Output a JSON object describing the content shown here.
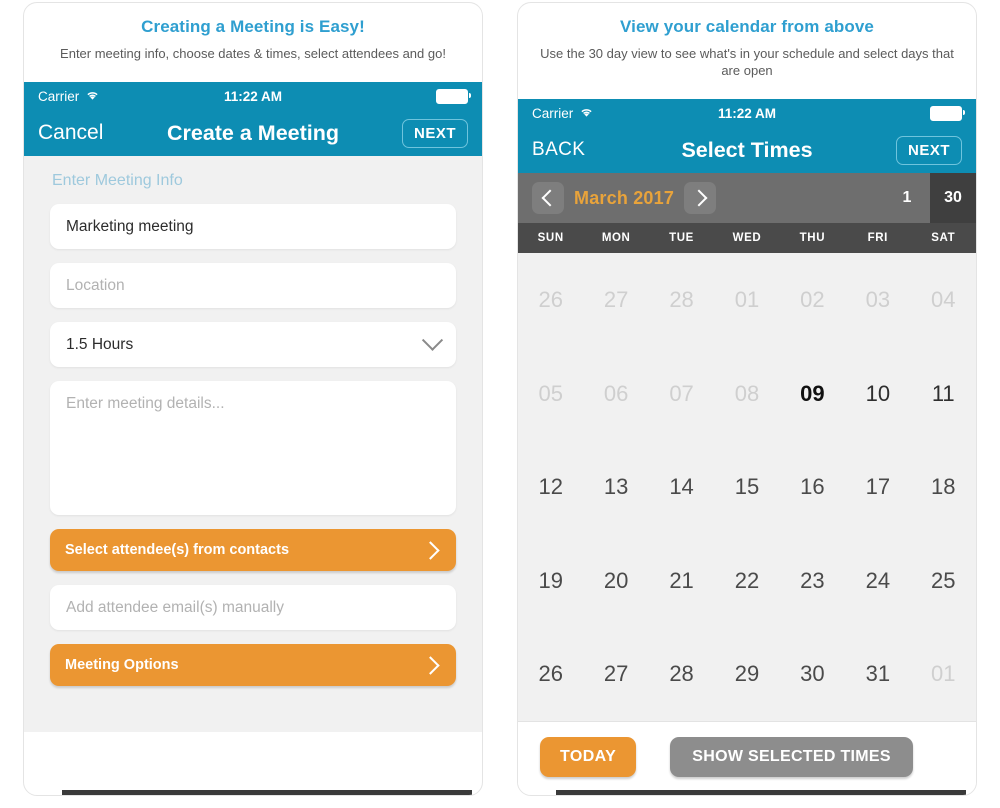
{
  "panels": {
    "left": {
      "promo_title": "Creating a Meeting is Easy!",
      "promo_sub": "Enter meeting info, choose dates & times, select attendees and go!",
      "status": {
        "carrier": "Carrier",
        "wifi_icon": "wifi-icon",
        "time": "11:22 AM",
        "battery_icon": "battery-icon"
      },
      "nav": {
        "left_label": "Cancel",
        "title": "Create a Meeting",
        "next_label": "NEXT"
      },
      "form": {
        "section_label": "Enter Meeting Info",
        "title_value": "Marketing meeting",
        "location_placeholder": "Location",
        "duration_value": "1.5 Hours",
        "duration_chevron_icon": "chevron-down-icon",
        "details_placeholder": "Enter meeting details...",
        "select_attendees_label": "Select attendee(s) from contacts",
        "email_placeholder": "Add attendee email(s) manually",
        "meeting_options_label": "Meeting Options",
        "row_chevron_icon": "chevron-right-icon"
      }
    },
    "right": {
      "promo_title": "View your calendar from above",
      "promo_sub": "Use the 30 day view to see what's in your schedule and select days that are open",
      "status": {
        "carrier": "Carrier",
        "wifi_icon": "wifi-icon",
        "time": "11:22 AM",
        "battery_icon": "battery-icon"
      },
      "nav": {
        "left_label": "BACK",
        "title": "Select Times",
        "next_label": "NEXT"
      },
      "calendar": {
        "prev_icon": "chevron-left-icon",
        "next_icon": "chevron-right-icon",
        "month_label": "March 2017",
        "view_tabs": [
          {
            "label": "1",
            "active": false
          },
          {
            "label": "30",
            "active": true
          }
        ],
        "day_headers": [
          "SUN",
          "MON",
          "TUE",
          "WED",
          "THU",
          "FRI",
          "SAT"
        ],
        "weeks": [
          [
            {
              "label": "26",
              "state": "muted"
            },
            {
              "label": "27",
              "state": "muted"
            },
            {
              "label": "28",
              "state": "muted"
            },
            {
              "label": "01",
              "state": "muted"
            },
            {
              "label": "02",
              "state": "muted"
            },
            {
              "label": "03",
              "state": "muted"
            },
            {
              "label": "04",
              "state": "muted"
            }
          ],
          [
            {
              "label": "05",
              "state": "muted"
            },
            {
              "label": "06",
              "state": "muted"
            },
            {
              "label": "07",
              "state": "muted"
            },
            {
              "label": "08",
              "state": "muted"
            },
            {
              "label": "09",
              "state": "today"
            },
            {
              "label": "10",
              "state": "strong"
            },
            {
              "label": "11",
              "state": "strong"
            }
          ],
          [
            {
              "label": "12",
              "state": "normal"
            },
            {
              "label": "13",
              "state": "normal"
            },
            {
              "label": "14",
              "state": "normal"
            },
            {
              "label": "15",
              "state": "normal"
            },
            {
              "label": "16",
              "state": "normal"
            },
            {
              "label": "17",
              "state": "normal"
            },
            {
              "label": "18",
              "state": "normal"
            }
          ],
          [
            {
              "label": "19",
              "state": "normal"
            },
            {
              "label": "20",
              "state": "normal"
            },
            {
              "label": "21",
              "state": "normal"
            },
            {
              "label": "22",
              "state": "normal"
            },
            {
              "label": "23",
              "state": "normal"
            },
            {
              "label": "24",
              "state": "normal"
            },
            {
              "label": "25",
              "state": "normal"
            }
          ],
          [
            {
              "label": "26",
              "state": "normal"
            },
            {
              "label": "27",
              "state": "normal"
            },
            {
              "label": "28",
              "state": "normal"
            },
            {
              "label": "29",
              "state": "normal"
            },
            {
              "label": "30",
              "state": "normal"
            },
            {
              "label": "31",
              "state": "normal"
            },
            {
              "label": "01",
              "state": "muted"
            }
          ]
        ],
        "today_button": "TODAY",
        "show_times_button": "SHOW SELECTED TIMES"
      }
    }
  },
  "colors": {
    "teal": "#0d8db3",
    "orange": "#eb9632",
    "promo_blue": "#2f9fd0",
    "cal_header_gray": "#6e6e6e",
    "cal_dow_gray": "#4a4a4a",
    "month_orange": "#e8a33b",
    "gray_button": "#8d8d8d"
  }
}
